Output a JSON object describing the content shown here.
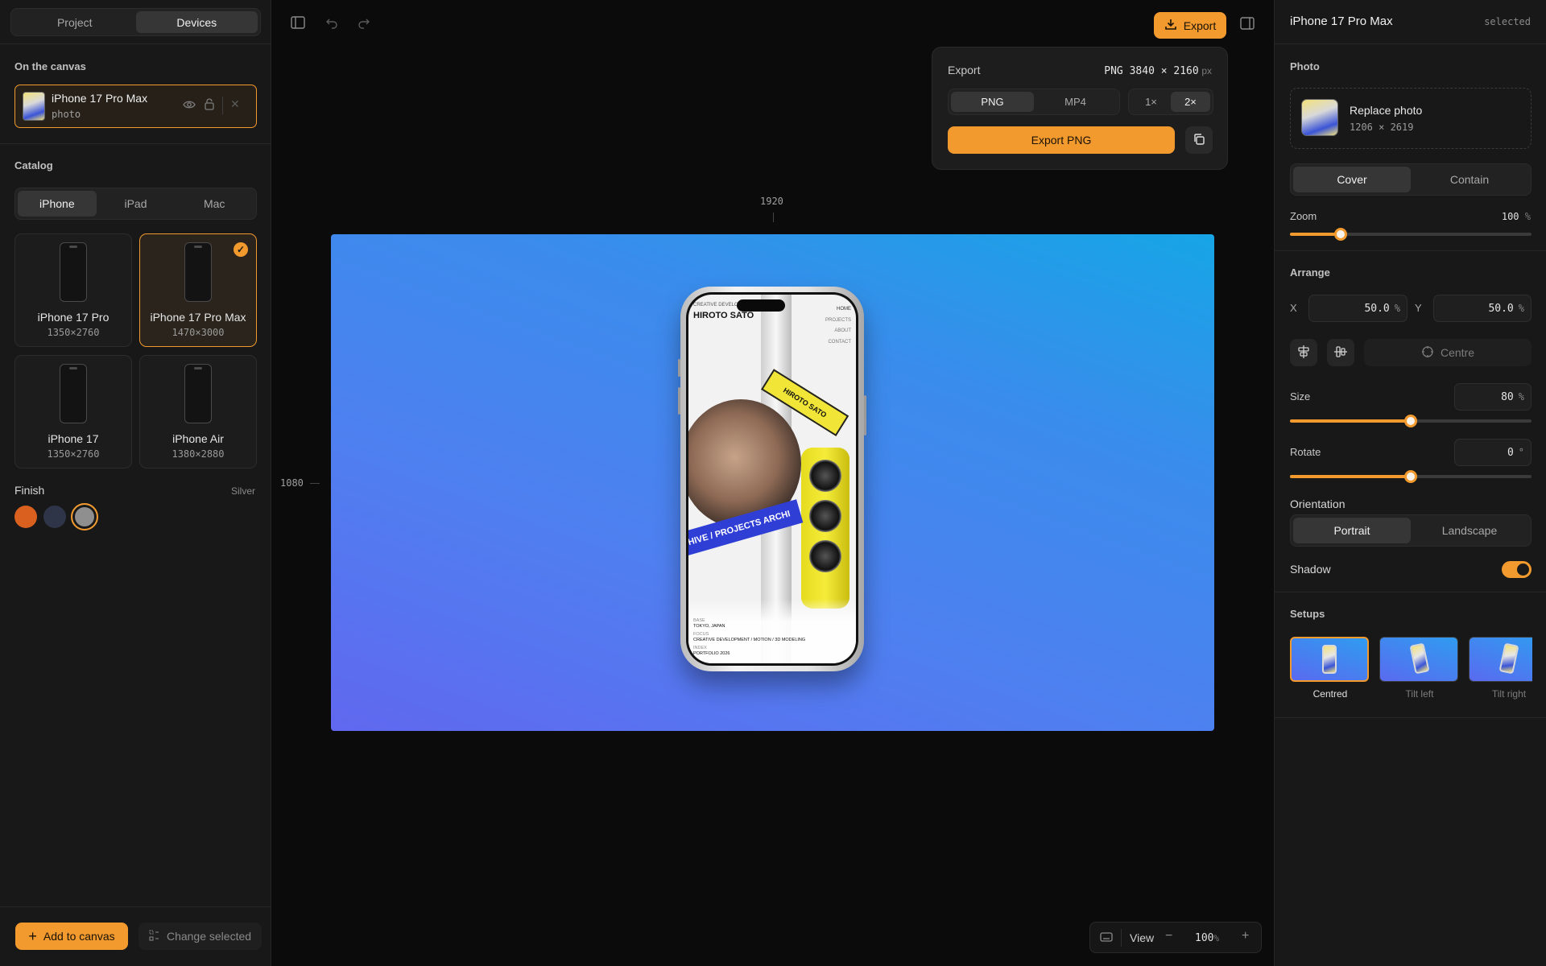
{
  "left": {
    "tabs": [
      "Project",
      "Devices"
    ],
    "active_tab": "Devices",
    "on_canvas_title": "On the canvas",
    "canvas_item": {
      "name": "iPhone 17 Pro Max",
      "type": "photo"
    },
    "catalog_title": "Catalog",
    "catalog_tabs": [
      "iPhone",
      "iPad",
      "Mac"
    ],
    "devices": [
      {
        "name": "iPhone 17 Pro",
        "res": "1350×2760"
      },
      {
        "name": "iPhone 17 Pro Max",
        "res": "1470×3000",
        "selected": true
      },
      {
        "name": "iPhone 17",
        "res": "1350×2760"
      },
      {
        "name": "iPhone Air",
        "res": "1380×2880"
      }
    ],
    "finish_title": "Finish",
    "finish_value": "Silver",
    "finish_colors": [
      "#d9601f",
      "#2f3548",
      "#8f8f8f"
    ],
    "add_button": "Add to canvas",
    "change_button": "Change selected"
  },
  "toolbar": {
    "export_label": "Export"
  },
  "export_popover": {
    "title": "Export",
    "format_info": "PNG 3840 × 2160",
    "format_unit": "px",
    "formats": [
      "PNG",
      "MP4"
    ],
    "scales": [
      "1×",
      "2×"
    ],
    "export_button": "Export PNG"
  },
  "canvas": {
    "width_label": "1920",
    "height_label": "1080",
    "screen": {
      "header_small": "CREATIVE DEVELOPER",
      "name": "HIROTO SATO",
      "nav": [
        "HOME",
        "PROJECTS",
        "ABOUT",
        "CONTACT"
      ],
      "sign_text": "HIROTO SATO",
      "banner_text": "HIVE / PROJECTS ARCHI",
      "base_label": "BASE",
      "base_value": "TOKYO, JAPAN",
      "focus_label": "FOCUS",
      "focus_value": "CREATIVE DEVELOPMENT / MOTION / 3D MODELING",
      "index_label": "INDEX",
      "index_value": "PORTFOLIO 2026"
    }
  },
  "view": {
    "label": "View",
    "zoom": "100",
    "unit": "%"
  },
  "right": {
    "title": "iPhone 17 Pro Max",
    "status": "selected",
    "photo_title": "Photo",
    "replace_label": "Replace photo",
    "photo_res": "1206 × 2619",
    "fit": [
      "Cover",
      "Contain"
    ],
    "zoom_label": "Zoom",
    "zoom_value": "100",
    "zoom_unit": "%",
    "zoom_fraction": 0.21,
    "arrange_title": "Arrange",
    "x_label": "X",
    "x_value": "50.0",
    "y_label": "Y",
    "y_value": "50.0",
    "pct": "%",
    "centre_label": "Centre",
    "size_label": "Size",
    "size_value": "80",
    "size_fraction": 0.5,
    "rotate_label": "Rotate",
    "rotate_value": "0",
    "rotate_unit": "°",
    "rotate_fraction": 0.5,
    "orientation_label": "Orientation",
    "orientation": [
      "Portrait",
      "Landscape"
    ],
    "shadow_label": "Shadow",
    "shadow_on": true,
    "setups_title": "Setups",
    "setups": [
      "Centred",
      "Tilt left",
      "Tilt right"
    ]
  },
  "colors": {
    "accent": "#f29a2e"
  }
}
